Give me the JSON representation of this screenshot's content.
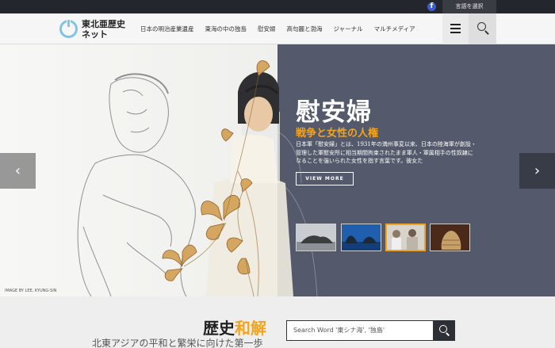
{
  "topbar": {
    "facebook_icon": "facebook-icon",
    "facebook_glyph": "f",
    "language_button": "言語を選択"
  },
  "header": {
    "logo_line1": "東北亜歴史",
    "logo_line2": "ネット",
    "nav": [
      "日本の明治産業遺産",
      "東海の中の独島",
      "慰安婦",
      "高句麗と渤海",
      "ジャーナル",
      "マルチメディア"
    ],
    "menu_icon": "hamburger-menu-icon",
    "search_icon": "search-icon"
  },
  "hero": {
    "title": "慰安婦",
    "subtitle": "戦争と女性の人権",
    "description": "日本軍「慰安婦」とは、1931年の満州事変以来、日本の陸海軍が創設・管理した軍慰安所に相当期間拘束されたまま軍人・軍属相手の性奴隷になることを強いられた女性を指す言葉です。彼女た",
    "view_more": "VIEW MORE",
    "prev_arrow": "‹",
    "next_arrow": "›",
    "image_credit": "IMAGE BY LEE, KYUNG-SIN",
    "thumbnails": [
      {
        "name": "island-thumbnail"
      },
      {
        "name": "sea-rocks-thumbnail"
      },
      {
        "name": "women-photo-thumbnail"
      },
      {
        "name": "artifact-thumbnail"
      }
    ],
    "accent_color": "#f2a31f",
    "panel_color": "#545a6b"
  },
  "bottom": {
    "title_part1": "歴史",
    "title_part2": "和解",
    "tagline": "北東アジアの平和と繁栄に向けた第一歩",
    "search_placeholder": "Search Word '東シナ海', '独島'"
  }
}
